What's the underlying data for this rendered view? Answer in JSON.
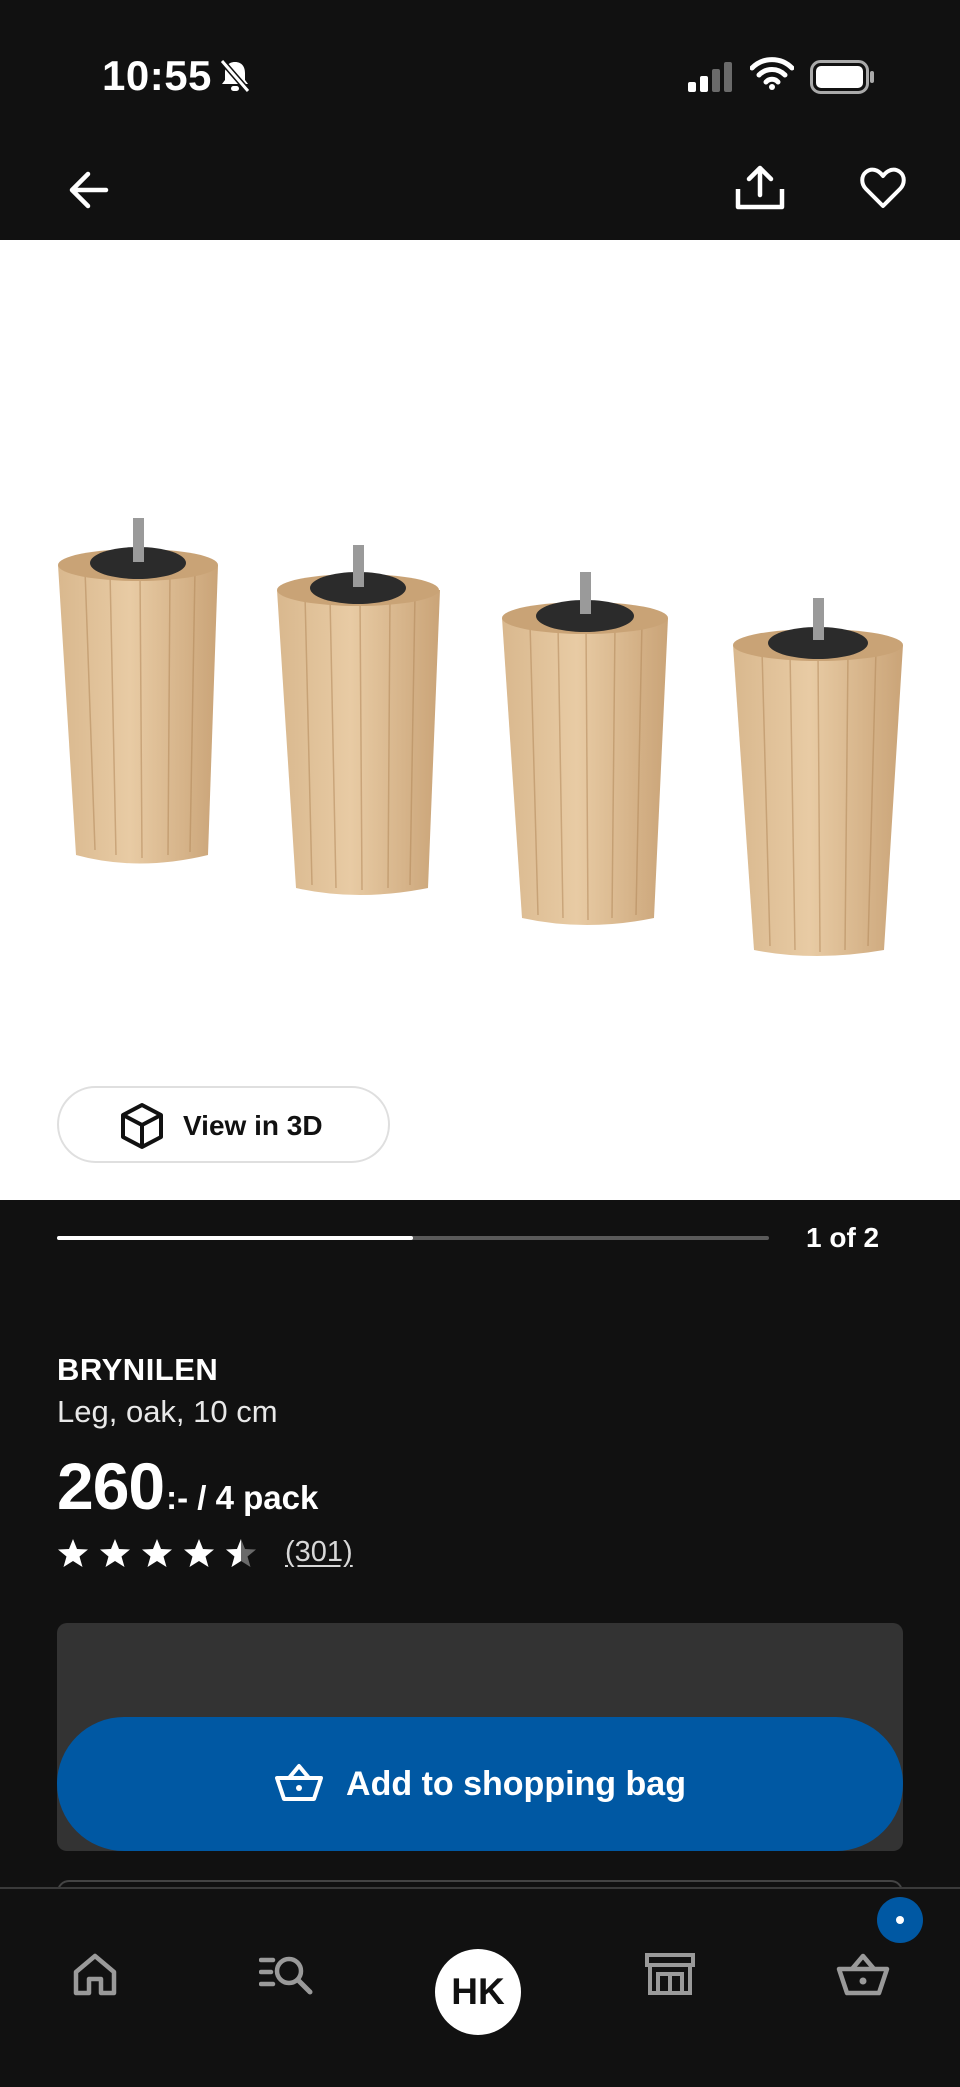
{
  "status_bar": {
    "time": "10:55",
    "bell_icon": "bell-slash-icon",
    "signal_icon": "cellular-signal-icon",
    "wifi_icon": "wifi-icon",
    "battery_icon": "battery-icon"
  },
  "top_nav": {
    "back_icon": "arrow-left-icon",
    "share_icon": "share-icon",
    "favorite_icon": "heart-icon"
  },
  "gallery": {
    "view_3d_label": "View in 3D",
    "view_3d_icon": "cube-icon",
    "progress_fraction": 0.5,
    "counter": "1 of 2"
  },
  "product": {
    "name": "BRYNILEN",
    "description": "Leg, oak, 10 cm",
    "price_main": "260",
    "price_suffix": ":- / 4 pack",
    "rating": 4.5,
    "review_count": "(301)"
  },
  "buy": {
    "add_label": "Add to shopping bag",
    "add_icon": "basket-icon",
    "accent_color": "#0058a3"
  },
  "bottom_nav": {
    "items": [
      {
        "icon": "home-icon"
      },
      {
        "icon": "search-list-icon"
      },
      {
        "avatar_label": "HK"
      },
      {
        "icon": "store-icon"
      },
      {
        "icon": "basket-icon"
      }
    ],
    "cart_badge_icon": "dot-icon"
  }
}
